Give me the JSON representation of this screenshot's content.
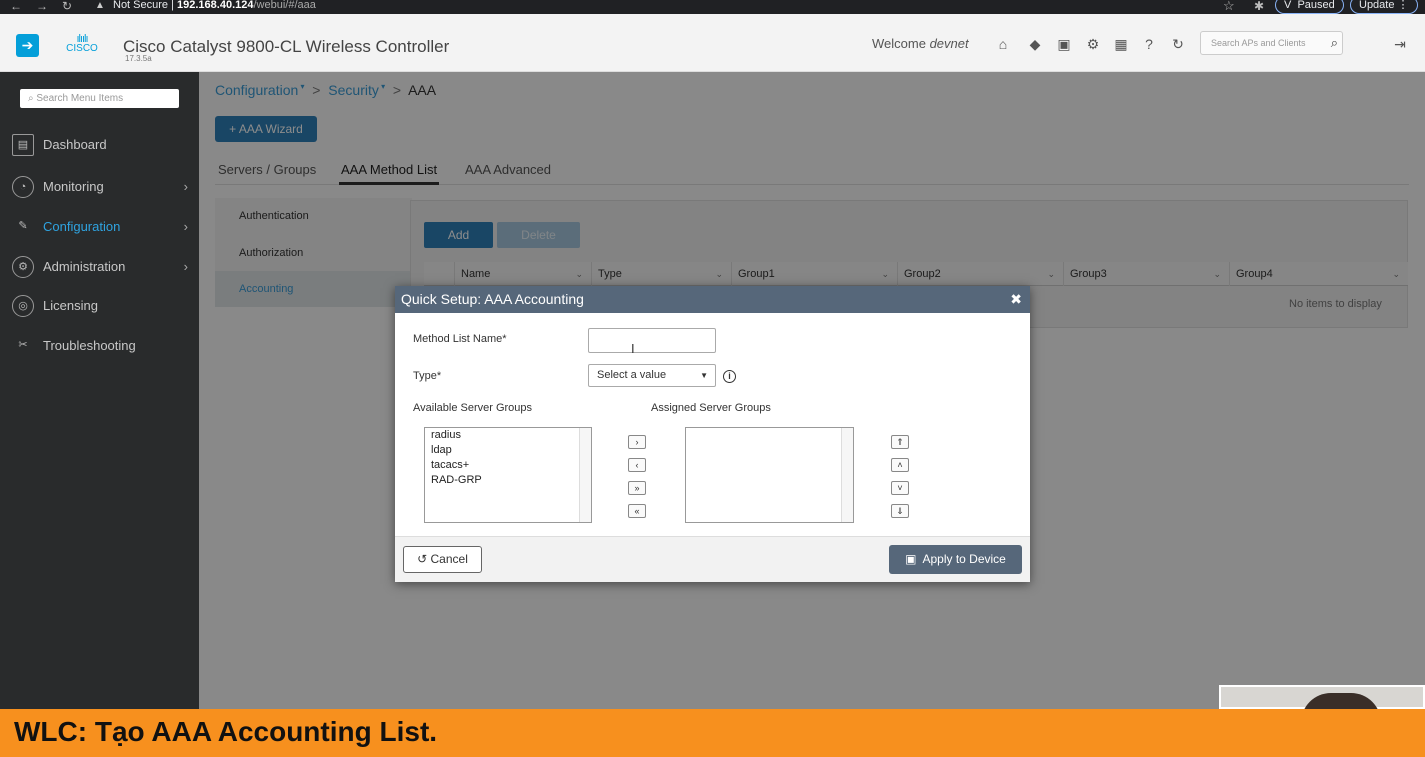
{
  "browser": {
    "security": "Not Secure",
    "url_host": "192.168.40.124",
    "url_path": "/webui/#/aaa",
    "profile": "V",
    "status": "Paused",
    "update": "Update"
  },
  "header": {
    "logo_text": "CISCO",
    "title": "Cisco Catalyst 9800-CL Wireless Controller",
    "version": "17.3.5a",
    "welcome": "Welcome",
    "user": "devnet",
    "search_placeholder": "Search APs and Clients"
  },
  "sidebar": {
    "search_placeholder": "Search Menu Items",
    "items": [
      {
        "label": "Dashboard"
      },
      {
        "label": "Monitoring"
      },
      {
        "label": "Configuration"
      },
      {
        "label": "Administration"
      },
      {
        "label": "Licensing"
      },
      {
        "label": "Troubleshooting"
      }
    ]
  },
  "breadcrumb": [
    "Configuration",
    "Security",
    "AAA"
  ],
  "wizard_label": "+ AAA Wizard",
  "tabs": [
    "Servers / Groups",
    "AAA Method List",
    "AAA Advanced"
  ],
  "subnav": [
    "Authentication",
    "Authorization",
    "Accounting"
  ],
  "toolbar": {
    "add": "Add",
    "delete": "Delete"
  },
  "table": {
    "columns": [
      "Name",
      "Type",
      "Group1",
      "Group2",
      "Group3",
      "Group4"
    ],
    "empty": "No items to display"
  },
  "modal": {
    "title": "Quick Setup: AAA Accounting",
    "name_label": "Method List Name*",
    "name_value": "",
    "type_label": "Type*",
    "type_value": "Select a value",
    "available_label": "Available Server Groups",
    "assigned_label": "Assigned Server Groups",
    "available": [
      "radius",
      "ldap",
      "tacacs+",
      "RAD-GRP"
    ],
    "assigned": [],
    "cancel": "Cancel",
    "apply": "Apply to Device"
  },
  "banner": "WLC: Tạo AAA Accounting List.",
  "colors": {
    "accent": "#049fd9",
    "modal_header": "#56677a",
    "banner": "#f7901e"
  }
}
